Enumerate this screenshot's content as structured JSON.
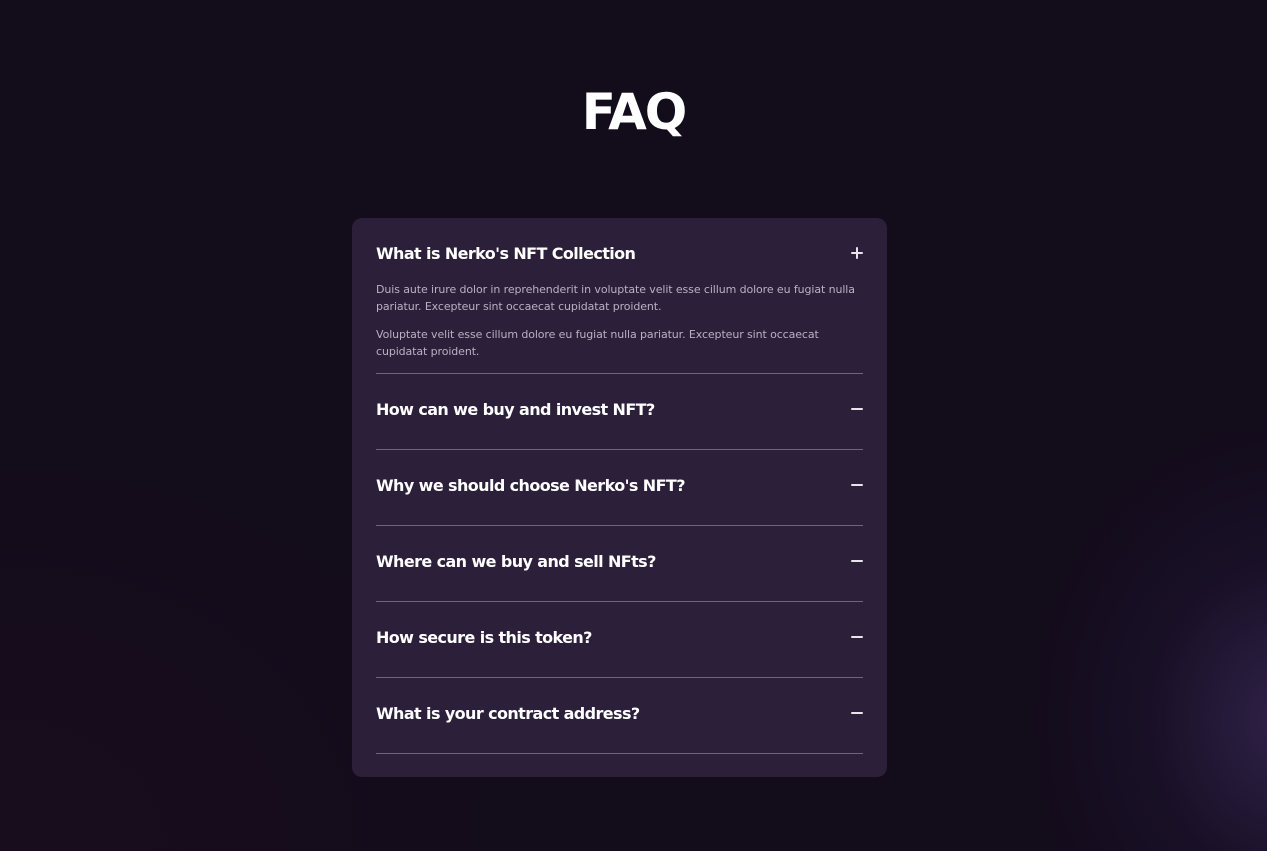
{
  "page": {
    "title": "FAQ"
  },
  "faq": {
    "items": [
      {
        "question": "What is Nerko's NFT Collection",
        "icon": "plus-icon",
        "expanded": true,
        "answer": [
          "Duis aute irure dolor in reprehenderit in voluptate velit esse cillum dolore eu fugiat nulla pariatur. Excepteur sint occaecat cupidatat proident.",
          "Voluptate velit esse cillum dolore eu fugiat nulla pariatur. Excepteur sint occaecat cupidatat proident."
        ]
      },
      {
        "question": "How can we buy and invest NFT?",
        "icon": "minus-icon",
        "expanded": false
      },
      {
        "question": "Why we should choose Nerko's NFT?",
        "icon": "minus-icon",
        "expanded": false
      },
      {
        "question": "Where can we buy and sell NFts?",
        "icon": "minus-icon",
        "expanded": false
      },
      {
        "question": "How secure is this token?",
        "icon": "minus-icon",
        "expanded": false
      },
      {
        "question": "What is your contract address?",
        "icon": "minus-icon",
        "expanded": false
      }
    ]
  },
  "colors": {
    "background": "#130c1b",
    "card": "#2c1f3a",
    "divider": "#6f6579",
    "heading": "#ffffff",
    "body_text": "#b9b1c2"
  }
}
